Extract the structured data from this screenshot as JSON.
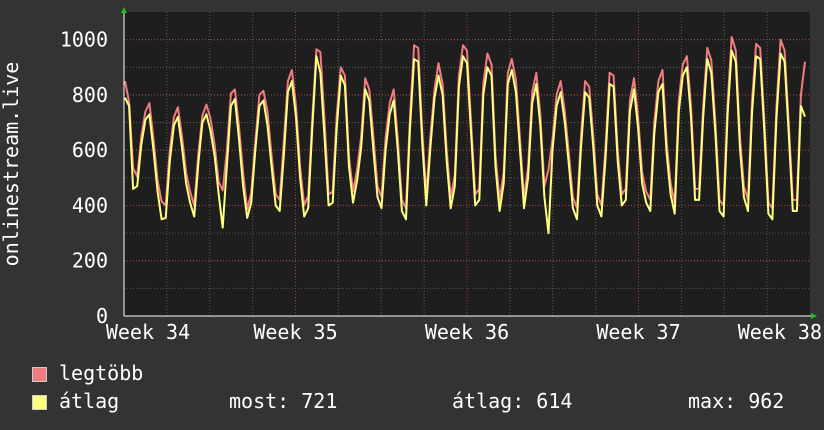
{
  "chart_data": {
    "type": "line",
    "ylabel": "onlinestream.live",
    "ylim": [
      0,
      1100
    ],
    "yticks": [
      0,
      200,
      400,
      600,
      800,
      1000
    ],
    "x_ticks": [
      "Week 34",
      "Week 35",
      "Week 36",
      "Week 37",
      "Week 38"
    ],
    "grid": true,
    "series": [
      {
        "name": "legtöbb",
        "color": "#f07c80",
        "values": [
          850,
          775,
          535,
          505,
          650,
          740,
          770,
          640,
          490,
          415,
          400,
          600,
          720,
          755,
          650,
          520,
          450,
          400,
          585,
          725,
          765,
          715,
          620,
          485,
          455,
          595,
          805,
          820,
          685,
          520,
          385,
          445,
          630,
          800,
          815,
          740,
          580,
          440,
          420,
          630,
          850,
          890,
          760,
          540,
          400,
          435,
          715,
          965,
          955,
          710,
          440,
          450,
          725,
          900,
          870,
          575,
          450,
          530,
          650,
          860,
          820,
          650,
          470,
          430,
          645,
          770,
          820,
          640,
          420,
          390,
          720,
          980,
          970,
          670,
          440,
          650,
          820,
          915,
          840,
          600,
          430,
          510,
          870,
          980,
          960,
          700,
          440,
          460,
          840,
          950,
          910,
          580,
          420,
          520,
          880,
          930,
          855,
          640,
          430,
          540,
          810,
          880,
          730,
          470,
          530,
          640,
          800,
          850,
          740,
          590,
          430,
          390,
          650,
          850,
          830,
          650,
          440,
          400,
          610,
          880,
          870,
          600,
          440,
          460,
          780,
          860,
          720,
          520,
          450,
          420,
          700,
          850,
          890,
          630,
          480,
          410,
          780,
          910,
          940,
          760,
          460,
          460,
          760,
          970,
          925,
          700,
          420,
          400,
          770,
          1010,
          960,
          650,
          470,
          420,
          780,
          985,
          970,
          710,
          410,
          390,
          760,
          1000,
          960,
          700,
          420,
          420,
          800,
          920
        ],
        "display": [
          "max: 962"
        ]
      },
      {
        "name": "átlag",
        "color": "#ffff80",
        "values": [
          790,
          760,
          460,
          470,
          620,
          710,
          730,
          600,
          450,
          350,
          355,
          560,
          690,
          720,
          610,
          480,
          410,
          360,
          550,
          700,
          730,
          670,
          580,
          440,
          320,
          540,
          760,
          785,
          640,
          470,
          355,
          410,
          600,
          760,
          780,
          690,
          540,
          400,
          380,
          580,
          810,
          850,
          720,
          500,
          360,
          390,
          680,
          940,
          880,
          650,
          400,
          410,
          680,
          870,
          835,
          540,
          410,
          490,
          610,
          820,
          780,
          600,
          430,
          390,
          600,
          730,
          780,
          600,
          380,
          350,
          680,
          930,
          920,
          630,
          400,
          610,
          790,
          870,
          800,
          560,
          390,
          470,
          830,
          940,
          915,
          660,
          400,
          420,
          800,
          900,
          870,
          540,
          380,
          480,
          840,
          890,
          810,
          600,
          390,
          500,
          770,
          840,
          690,
          430,
          300,
          600,
          760,
          810,
          700,
          550,
          390,
          350,
          610,
          810,
          790,
          610,
          400,
          360,
          570,
          840,
          830,
          560,
          400,
          420,
          740,
          820,
          680,
          480,
          410,
          380,
          660,
          810,
          840,
          590,
          440,
          370,
          740,
          870,
          900,
          720,
          420,
          420,
          720,
          930,
          880,
          660,
          380,
          360,
          730,
          960,
          920,
          610,
          430,
          380,
          740,
          940,
          930,
          670,
          370,
          350,
          720,
          950,
          920,
          660,
          380,
          380,
          760,
          721
        ]
      }
    ]
  },
  "legend": {
    "items": [
      {
        "label": "legtöbb",
        "color": "#f07c80"
      },
      {
        "label": "átlag",
        "color": "#ffff80"
      }
    ],
    "stats": {
      "most": "most: 721",
      "atlag": "átlag: 614",
      "max": "max: 962"
    }
  }
}
